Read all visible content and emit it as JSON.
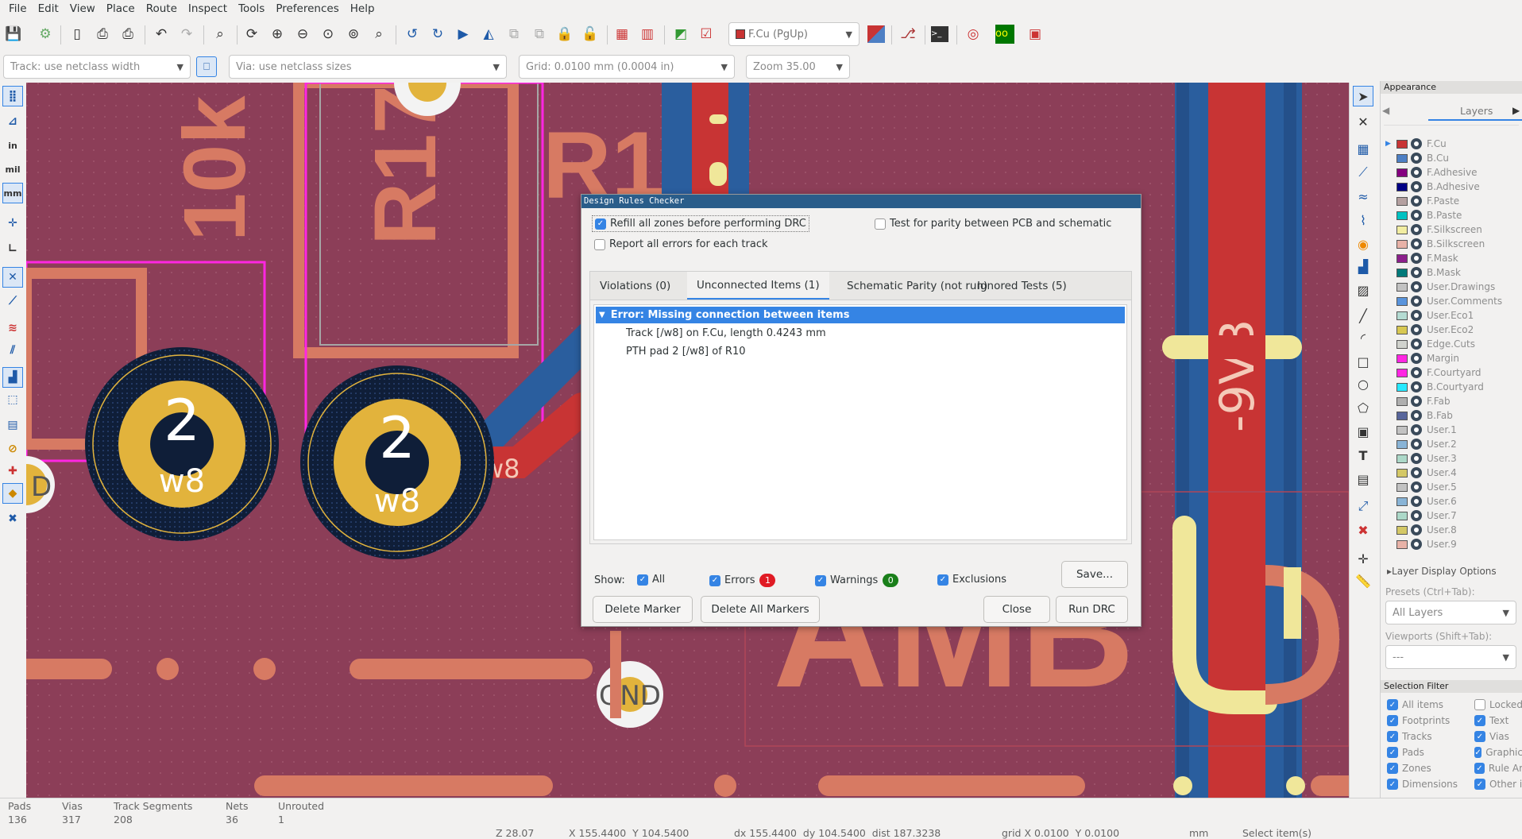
{
  "menu": [
    "File",
    "Edit",
    "View",
    "Place",
    "Route",
    "Inspect",
    "Tools",
    "Preferences",
    "Help"
  ],
  "toolbar": {
    "layer_combo": "F.Cu (PgUp)",
    "layer_color": "#c83434"
  },
  "options": {
    "track": "Track: use netclass width",
    "via": "Via: use netclass sizes",
    "grid": "Grid: 0.0100 mm (0.0004 in)",
    "zoom": "Zoom 35.00"
  },
  "left_toolbar": {
    "in": "in",
    "mil": "mil",
    "mm": "mm"
  },
  "canvas": {
    "silk": [
      "10k",
      "R17",
      "R1",
      "AMB",
      "-9VB"
    ],
    "pads": [
      {
        "num": "2",
        "net": "w8"
      },
      {
        "num": "2",
        "net": "w8"
      }
    ],
    "gnd_label": "GND",
    "track_label": "w8",
    "partial_d": "D"
  },
  "appearance": {
    "title": "Appearance",
    "layers_tab": "Layers",
    "layers": [
      {
        "name": "F.Cu",
        "color": "#c83434"
      },
      {
        "name": "B.Cu",
        "color": "#4d7fc4"
      },
      {
        "name": "F.Adhesive",
        "color": "#84007f"
      },
      {
        "name": "B.Adhesive",
        "color": "#000084"
      },
      {
        "name": "F.Paste",
        "color": "#b4a0a0"
      },
      {
        "name": "B.Paste",
        "color": "#00c2c2"
      },
      {
        "name": "F.Silkscreen",
        "color": "#f2eda1"
      },
      {
        "name": "B.Silkscreen",
        "color": "#e8b2a7"
      },
      {
        "name": "F.Mask",
        "color": "#8b1f8b"
      },
      {
        "name": "B.Mask",
        "color": "#027a7a"
      },
      {
        "name": "User.Drawings",
        "color": "#c2c2c2"
      },
      {
        "name": "User.Comments",
        "color": "#5994dc"
      },
      {
        "name": "User.Eco1",
        "color": "#b4dbd2"
      },
      {
        "name": "User.Eco2",
        "color": "#d8c852"
      },
      {
        "name": "Edge.Cuts",
        "color": "#d0d2cd"
      },
      {
        "name": "Margin",
        "color": "#ff26e2"
      },
      {
        "name": "F.Courtyard",
        "color": "#ff26e2"
      },
      {
        "name": "B.Courtyard",
        "color": "#26e9ff"
      },
      {
        "name": "F.Fab",
        "color": "#afafaf"
      },
      {
        "name": "B.Fab",
        "color": "#58659b"
      },
      {
        "name": "User.1",
        "color": "#c2c2c2"
      },
      {
        "name": "User.2",
        "color": "#89b4d6"
      },
      {
        "name": "User.3",
        "color": "#acd8c8"
      },
      {
        "name": "User.4",
        "color": "#d4c866"
      },
      {
        "name": "User.5",
        "color": "#c2c2c2"
      },
      {
        "name": "User.6",
        "color": "#89b4d6"
      },
      {
        "name": "User.7",
        "color": "#acd8c8"
      },
      {
        "name": "User.8",
        "color": "#d4c866"
      },
      {
        "name": "User.9",
        "color": "#e8b2a7"
      }
    ],
    "layer_display_options": "Layer Display Options",
    "presets_label": "Presets (Ctrl+Tab):",
    "presets_value": "All Layers",
    "viewports_label": "Viewports (Shift+Tab):",
    "viewports_value": "---",
    "selection_filter_title": "Selection Filter",
    "filters_left": [
      "All items",
      "Footprints",
      "Tracks",
      "Pads",
      "Zones",
      "Dimensions"
    ],
    "filters_right": [
      {
        "label": "Locked",
        "checked": false
      },
      {
        "label": "Text",
        "checked": true
      },
      {
        "label": "Vias",
        "checked": true
      },
      {
        "label": "Graphic",
        "checked": true
      },
      {
        "label": "Rule Ar",
        "checked": true
      },
      {
        "label": "Other i",
        "checked": true
      }
    ]
  },
  "status": {
    "headers": [
      "Pads",
      "Vias",
      "Track Segments",
      "Nets",
      "Unrouted"
    ],
    "values": [
      "136",
      "317",
      "208",
      "36",
      "1"
    ],
    "z": "Z 28.07",
    "xy": "X 155.4400  Y 104.5400",
    "dxy": "dx 155.4400  dy 104.5400  dist 187.3238",
    "grid": "grid X 0.0100  Y 0.0100",
    "units": "mm",
    "mode": "Select item(s)"
  },
  "dialog": {
    "title": "Design Rules Checker",
    "refill": "Refill all zones before performing DRC",
    "parity": "Test for parity between PCB and schematic",
    "report_all": "Report all errors for each track",
    "tabs": [
      "Violations (0)",
      "Unconnected Items (1)",
      "Schematic Parity (not run)",
      "Ignored Tests (5)"
    ],
    "error_header": "Error: Missing connection between items",
    "error_items": [
      "Track [/w8] on F.Cu, length 0.4243 mm",
      "PTH pad 2 [/w8] of R10"
    ],
    "show_label": "Show:",
    "show_all": "All",
    "errors": "Errors",
    "errors_count": "1",
    "warnings": "Warnings",
    "warnings_count": "0",
    "exclusions": "Exclusions",
    "save": "Save...",
    "delete_marker": "Delete Marker",
    "delete_all": "Delete All Markers",
    "close": "Close",
    "run": "Run DRC"
  }
}
